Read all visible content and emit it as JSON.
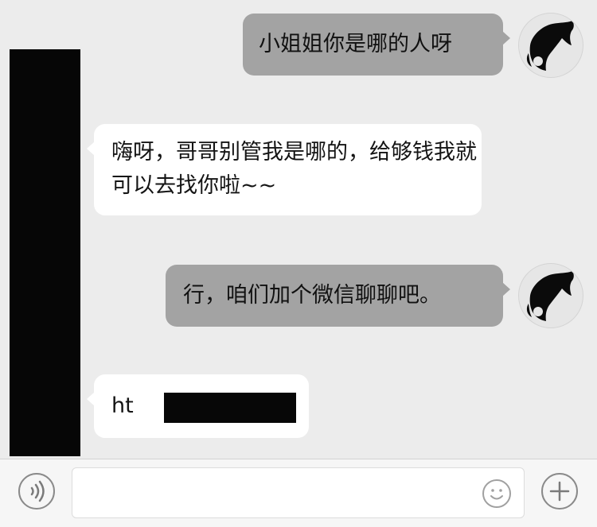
{
  "messages": [
    {
      "direction": "outgoing",
      "text": "小姐姐你是哪的人呀"
    },
    {
      "direction": "incoming",
      "text": "嗨呀，哥哥别管我是哪的，给够钱我就可以去找你啦~~"
    },
    {
      "direction": "outgoing",
      "text": "行，咱们加个微信聊聊吧。"
    },
    {
      "direction": "incoming",
      "text": "ht"
    }
  ],
  "icons": {
    "voice": "voice-icon",
    "emoji": "emoji-icon",
    "plus": "plus-icon",
    "avatar": "horse-avatar"
  },
  "colors": {
    "outgoing_bubble": "#a3a3a3",
    "incoming_bubble": "#ffffff",
    "background": "#ececec",
    "redaction": "#060606"
  }
}
